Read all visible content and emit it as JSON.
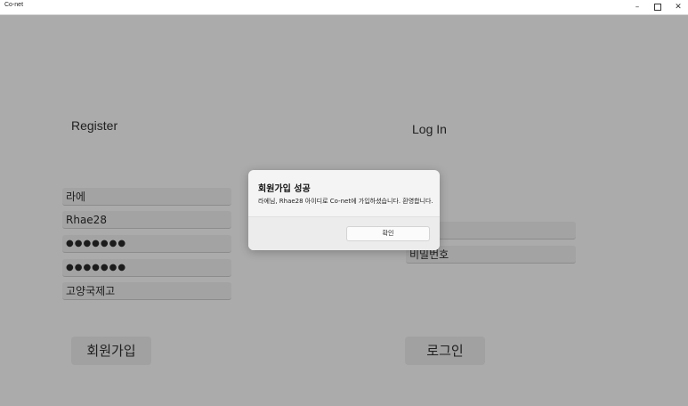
{
  "window": {
    "title": "Co-net",
    "controls": {
      "minimize": "–",
      "maximize_icon": "maximize-icon",
      "close": "✕"
    }
  },
  "register": {
    "heading": "Register",
    "fields": {
      "name": "라에",
      "id": "Rhae28",
      "password": "●●●●●●●",
      "password_confirm": "●●●●●●●",
      "school": "고양국제고"
    },
    "submit_label": "회원가입"
  },
  "login": {
    "heading": "Log In",
    "password_placeholder": "비밀번호",
    "submit_label": "로그인"
  },
  "dialog": {
    "title": "회원가입 성공",
    "message": "라에님, Rhae28 아이디로 Co-net에 가입하셨습니다. 환영합니다.",
    "ok_label": "확인"
  }
}
